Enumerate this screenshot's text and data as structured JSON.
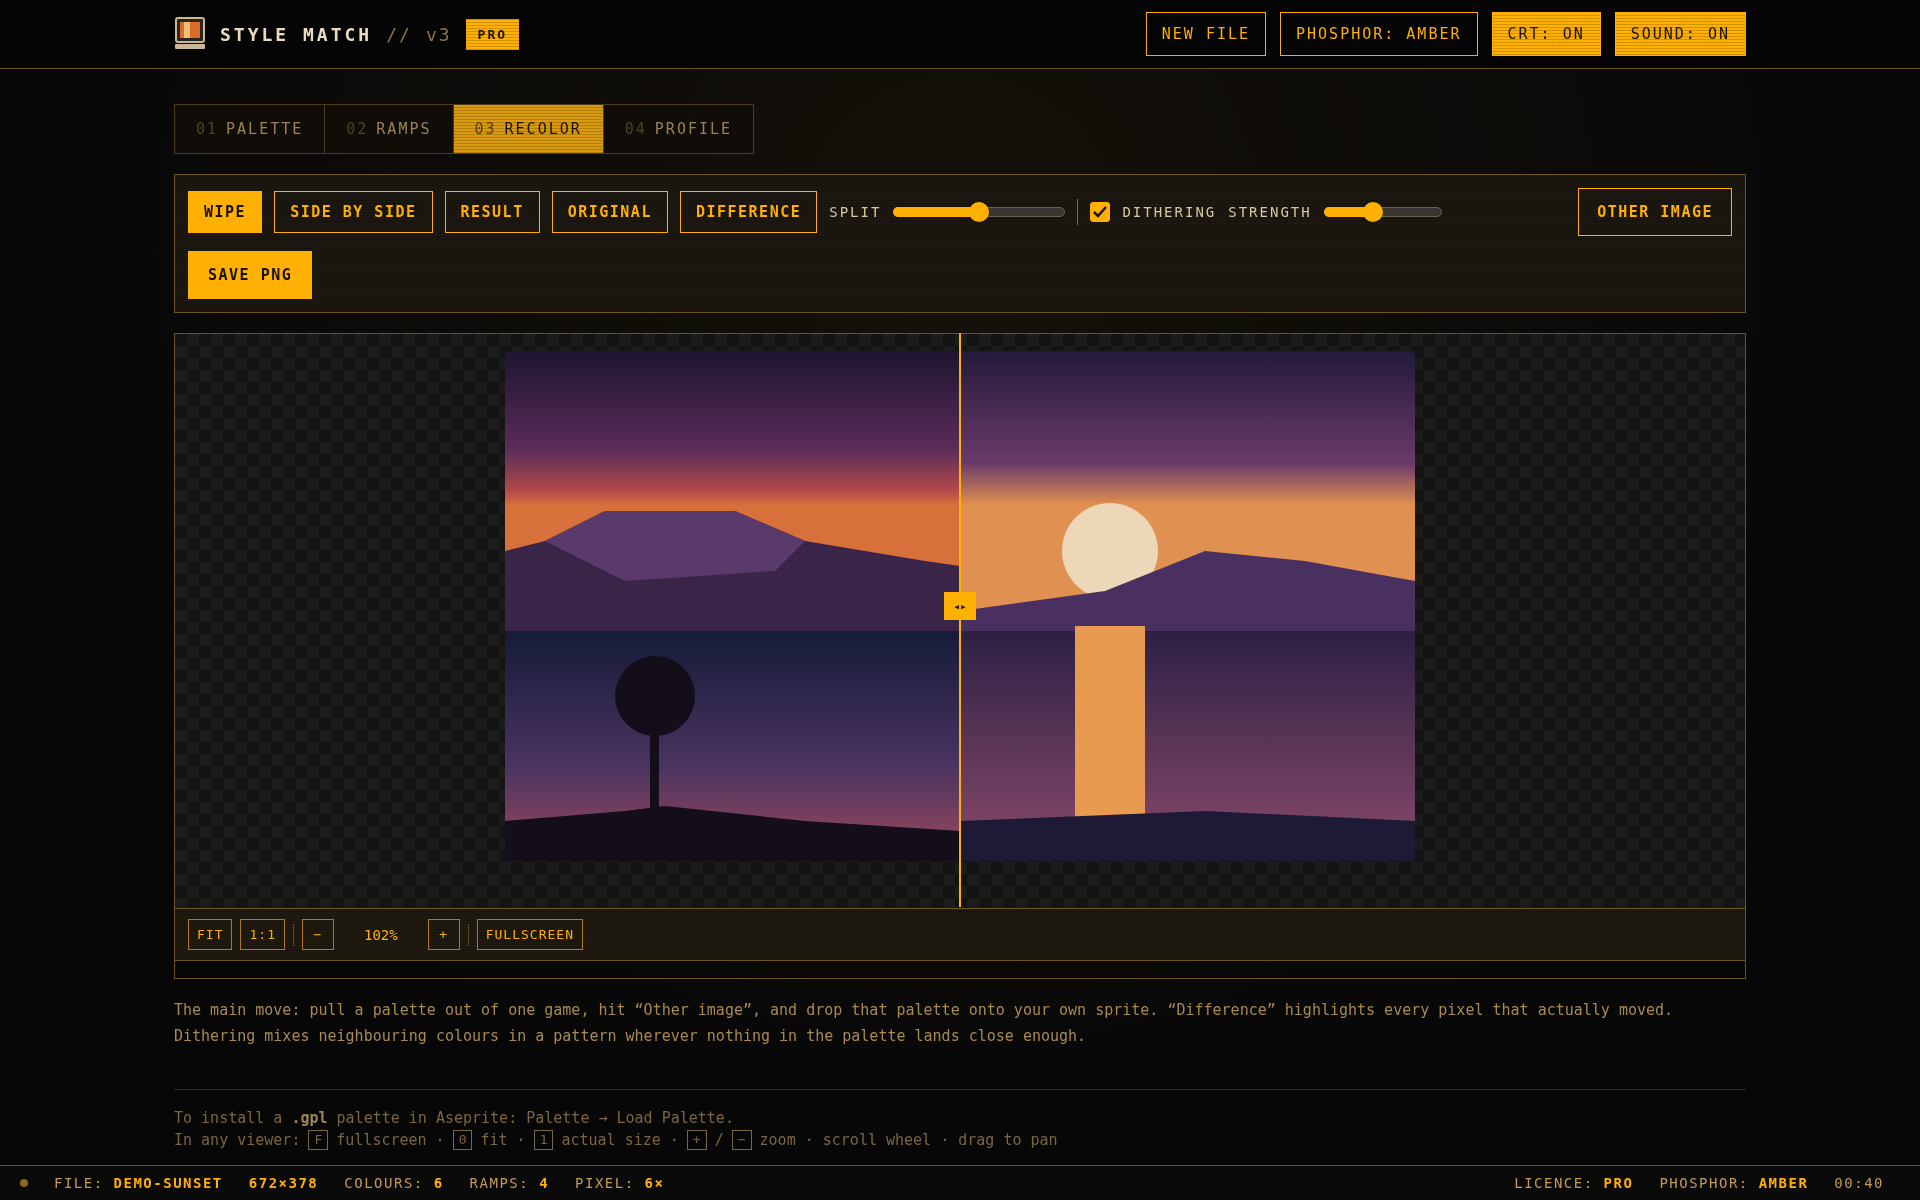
{
  "header": {
    "title": "STYLE MATCH",
    "separator": "//",
    "version": "v3",
    "badge": "PRO",
    "buttons": [
      {
        "label": "NEW FILE",
        "active": false
      },
      {
        "label": "PHOSPHOR: AMBER",
        "active": false
      },
      {
        "label": "CRT: ON",
        "active": true
      },
      {
        "label": "SOUND: ON",
        "active": true
      }
    ]
  },
  "tabs": [
    {
      "number": "01",
      "label": "PALETTE",
      "selected": false
    },
    {
      "number": "02",
      "label": "RAMPS",
      "selected": false
    },
    {
      "number": "03",
      "label": "RECOLOR",
      "selected": true
    },
    {
      "number": "04",
      "label": "PROFILE",
      "selected": false
    }
  ],
  "toolbar": {
    "modes": [
      {
        "label": "WIPE",
        "selected": true
      },
      {
        "label": "SIDE BY SIDE",
        "selected": false
      },
      {
        "label": "RESULT",
        "selected": false
      },
      {
        "label": "ORIGINAL",
        "selected": false
      },
      {
        "label": "DIFFERENCE",
        "selected": false
      }
    ],
    "split": {
      "label": "SPLIT",
      "level": 0.5
    },
    "dithering": {
      "label": "DITHERING",
      "checked": true
    },
    "strength": {
      "label": "STRENGTH",
      "level": 0.4
    },
    "other_button": "OTHER IMAGE",
    "save_button": "SAVE PNG"
  },
  "viewer": {
    "split_handle": "◂▸",
    "controls": [
      {
        "kind": "button",
        "label": "FIT"
      },
      {
        "kind": "button",
        "label": "1:1"
      },
      {
        "kind": "divider"
      },
      {
        "kind": "button",
        "label": "−"
      },
      {
        "kind": "readout",
        "label": "102%"
      },
      {
        "kind": "button",
        "label": "+"
      },
      {
        "kind": "divider"
      },
      {
        "kind": "button",
        "label": "FULLSCREEN"
      }
    ]
  },
  "description": [
    "The main move: pull a palette out of one game, hit “Other image”, and drop that palette onto your own sprite. “Difference” highlights every pixel that actually moved.",
    "Dithering mixes neighbouring colours in a pattern wherever nothing in the palette lands close enough."
  ],
  "install_note": "To install a **.gpl** palette in Aseprite: Palette → Load Palette.",
  "help": [
    {
      "kind": "text",
      "text": "In any viewer:"
    },
    {
      "kind": "key",
      "text": "F"
    },
    {
      "kind": "text",
      "text": "fullscreen ·"
    },
    {
      "kind": "key",
      "text": "0"
    },
    {
      "kind": "text",
      "text": "fit ·"
    },
    {
      "kind": "key",
      "text": "1"
    },
    {
      "kind": "text",
      "text": "actual size ·"
    },
    {
      "kind": "key",
      "text": "+"
    },
    {
      "kind": "text",
      "text": "/"
    },
    {
      "kind": "key",
      "text": "−"
    },
    {
      "kind": "text",
      "text": "zoom · scroll wheel · drag to pan"
    }
  ],
  "status_bar": {
    "left": [
      {
        "label": "FILE:",
        "value": "DEMO-SUNSET"
      },
      {
        "value": "672×378"
      },
      {
        "label": "COLOURS:",
        "value": "6"
      },
      {
        "label": "RAMPS:",
        "value": "4"
      },
      {
        "label": "PIXEL:",
        "value": "6×"
      }
    ],
    "right": [
      {
        "label": "LICENCE:",
        "value": "PRO"
      },
      {
        "label": "PHOSPHOR:",
        "value": "AMBER"
      },
      {
        "label": "00:40"
      }
    ]
  }
}
